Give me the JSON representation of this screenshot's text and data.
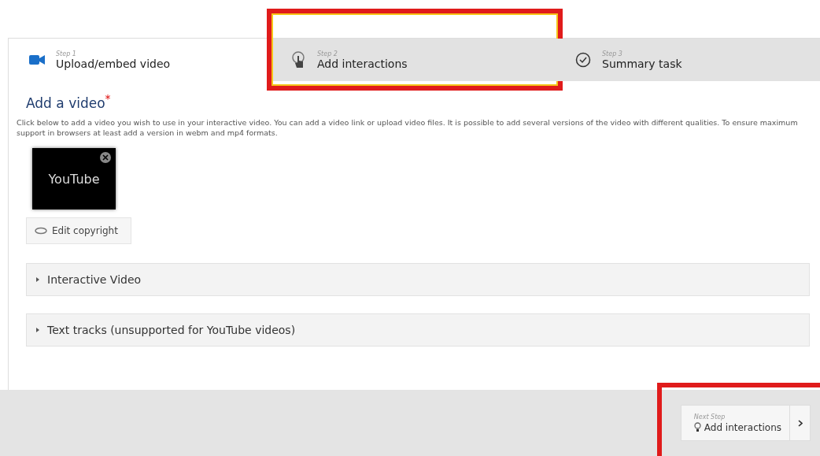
{
  "steps": [
    {
      "step": "Step 1",
      "label": "Upload/embed video",
      "kind": "video",
      "selected": true,
      "highlighted": false
    },
    {
      "step": "Step 2",
      "label": "Add interactions",
      "kind": "interactions",
      "selected": false,
      "highlighted": true
    },
    {
      "step": "Step 3",
      "label": "Summary task",
      "kind": "summary",
      "selected": false,
      "highlighted": false
    }
  ],
  "section": {
    "title": "Add a video",
    "required_mark": "*",
    "description": "Click below to add a video you wish to use in your interactive video. You can add a video link or upload video files. It is possible to add several versions of the video with different qualities. To ensure maximum support in browsers at least add a version in webm and mp4 formats."
  },
  "video_thumbnail": {
    "label": "YouTube"
  },
  "copyright_button": "Edit copyright",
  "accordions": [
    {
      "label": "Interactive Video",
      "expanded": false
    },
    {
      "label": "Text tracks (unsupported for YouTube videos)",
      "expanded": false
    }
  ],
  "next_step": {
    "caption": "Next Step",
    "label": "Add interactions",
    "highlighted": true
  }
}
